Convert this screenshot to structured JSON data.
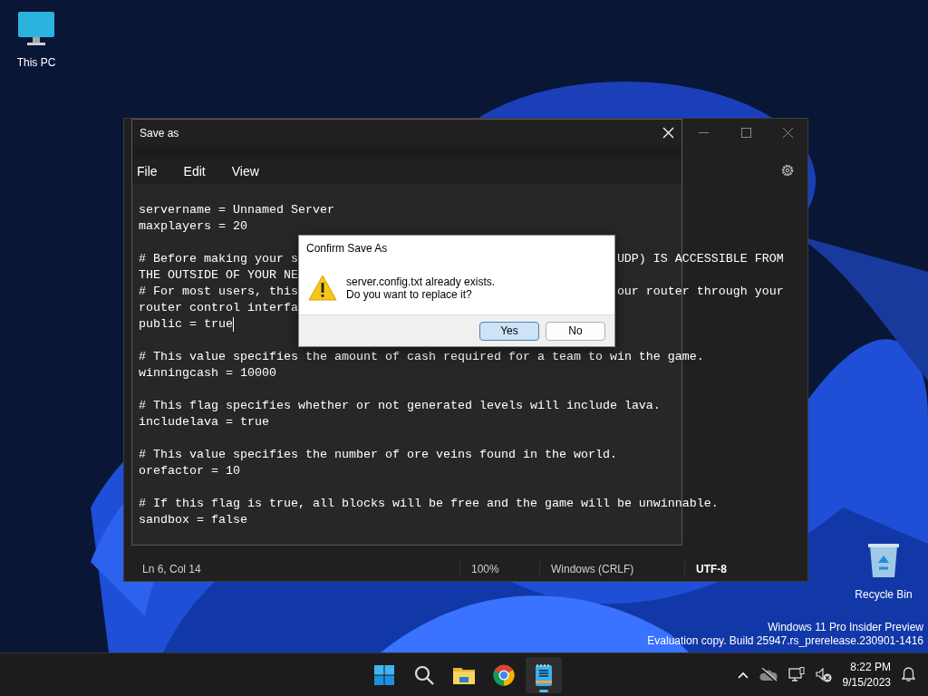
{
  "desktop_icons": [
    {
      "label": "This PC",
      "kind": "computer"
    },
    {
      "label": "Recycle Bin",
      "kind": "recycle"
    }
  ],
  "notepad": {
    "status_bar": [
      {
        "text": "Ln 6, Col 14",
        "bold": false
      },
      {
        "text": "100%",
        "bold": false
      },
      {
        "text": "Windows (CRLF)",
        "bold": false
      },
      {
        "text": "UTF-8",
        "bold": true
      }
    ]
  },
  "save_as": {
    "title": "Save as",
    "menu": [
      "File",
      "Edit",
      "View"
    ],
    "lines": [
      {
        "segments": [
          "servername = Unnamed Server"
        ],
        "caret": false
      },
      {
        "segments": [
          "maxplayers = 20"
        ],
        "caret": false
      },
      {
        "caret": false
      },
      {
        "segments": [
          "# Before making your s",
          "UDP) IS ACCESSIBLE FROM"
        ],
        "caret": false
      },
      {
        "segments": [
          "THE OUTSIDE OF YOUR NE"
        ],
        "caret": false
      },
      {
        "segments": [
          "# For most users, this",
          "our router through your"
        ],
        "caret": false
      },
      {
        "segments": [
          "router control interfa"
        ],
        "caret": false
      },
      {
        "segments": [
          "public = true"
        ],
        "caret": true
      },
      {
        "caret": false
      },
      {
        "segments": [
          "# This value specifies the amount of cash required for a team to win the game."
        ],
        "caret": false
      },
      {
        "segments": [
          "winningcash = 10000"
        ],
        "caret": false
      },
      {
        "caret": false
      },
      {
        "segments": [
          "# This flag specifies whether or not generated levels will include lava."
        ],
        "caret": false
      },
      {
        "segments": [
          "includelava = true"
        ],
        "caret": false
      },
      {
        "caret": false
      },
      {
        "segments": [
          "# This value specifies the number of ore veins found in the world."
        ],
        "caret": false
      },
      {
        "segments": [
          "orefactor = 10"
        ],
        "caret": false
      },
      {
        "caret": false
      },
      {
        "segments": [
          "# If this flag is true, all blocks will be free and the game will be unwinnable."
        ],
        "caret": false
      },
      {
        "segments": [
          "sandbox = false"
        ],
        "caret": false
      }
    ]
  },
  "confirm": {
    "title": "Confirm Save As",
    "message": [
      "server.config.txt already exists.",
      "Do you want to replace it?"
    ],
    "buttons": [
      {
        "label": "Yes",
        "selected": true
      },
      {
        "label": "No",
        "selected": false
      }
    ]
  },
  "build_notice": [
    "Windows 11 Pro Insider Preview",
    "Evaluation copy. Build 25947.rs_prerelease.230901-1416"
  ],
  "taskbar": {
    "apps": [
      {
        "kind": "start",
        "selected": false
      },
      {
        "kind": "search",
        "selected": false
      },
      {
        "kind": "folder",
        "selected": false
      },
      {
        "kind": "browser",
        "selected": false
      },
      {
        "kind": "notepad",
        "selected": true
      }
    ],
    "time": "8:22 PM",
    "date": "9/15/2023"
  }
}
